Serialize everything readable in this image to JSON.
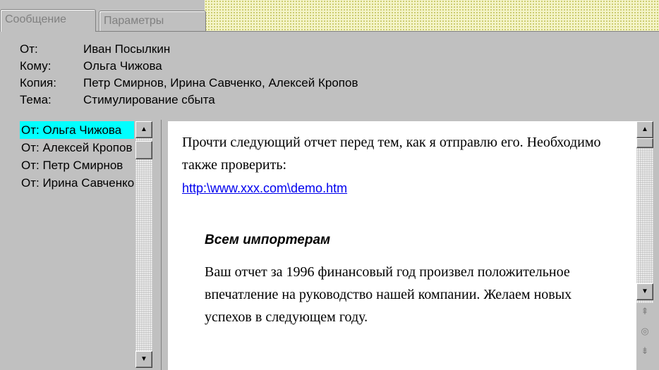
{
  "tabs": [
    {
      "label": "Сообщение"
    },
    {
      "label": "Параметры"
    }
  ],
  "header": {
    "from_label": "От:",
    "from_value": "Иван Посылкин",
    "to_label": "Кому:",
    "to_value": "Ольга Чижова",
    "cc_label": "Копия:",
    "cc_value": "Петр Смирнов, Ирина Савченко, Алексей Кропов",
    "subject_label": "Тема:",
    "subject_value": "Стимулирование сбыта"
  },
  "list": {
    "items": [
      {
        "label": "От: Ольга Чижова"
      },
      {
        "label": "От: Алексей Кропов"
      },
      {
        "label": "От: Петр Смирнов"
      },
      {
        "label": "От: Ирина Савченко"
      }
    ]
  },
  "message": {
    "paragraph1": "Прочти следующий отчет перед тем, как я отправлю его. Необходимо также проверить:",
    "link": "http:\\www.xxx.com\\demo.htm",
    "subheading": "Всем импортерам",
    "paragraph2": "Ваш отчет за 1996 финансовый год произвел положительное впечатление на руководство нашей компании. Желаем новых успехов в следующем году."
  },
  "icons": {
    "scroll_up": "arrow-up-icon",
    "scroll_down": "arrow-down-icon",
    "prev_page": "double-arrow-up-icon",
    "browse": "browse-object-icon",
    "next_page": "double-arrow-down-icon"
  },
  "colors": {
    "selection": "#00ffff",
    "link": "#0000ee",
    "background": "#c0c0c0"
  }
}
